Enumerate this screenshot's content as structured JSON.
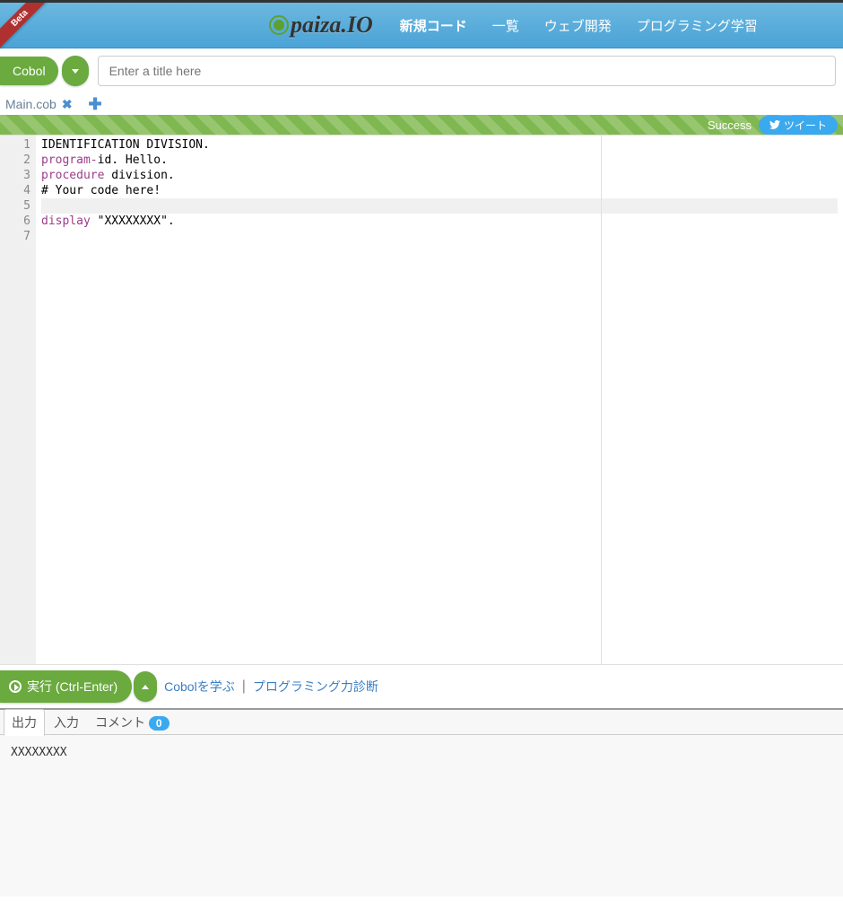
{
  "ribbon": "Beta",
  "logo": "paiza.IO",
  "nav": {
    "new_code": "新規コード",
    "list": "一覧",
    "web_dev": "ウェブ開発",
    "learning": "プログラミング学習"
  },
  "language_button": "Cobol",
  "title_placeholder": "Enter a title here",
  "file_tab": "Main.cob",
  "status": "Success",
  "tweet": "ツイート",
  "code": {
    "lines": [
      "1",
      "2",
      "3",
      "4",
      "5",
      "6",
      "7"
    ],
    "l1": "IDENTIFICATION DIVISION.",
    "l2a": "program-",
    "l2b": "id. Hello.",
    "l3a": "procedure",
    "l3b": " division.",
    "l4": "# Your code here!",
    "l5": "",
    "l6a": "display",
    "l6b": " \"XXXXXXXX\".",
    "l7": ""
  },
  "run_button": "実行 (Ctrl-Enter)",
  "learn_link": "Cobolを学ぶ",
  "separator": " | ",
  "diag_link": "プログラミング力診断",
  "output_tabs": {
    "output": "出力",
    "input": "入力",
    "comment": "コメント",
    "comment_count": "0"
  },
  "output_text": "XXXXXXXX"
}
